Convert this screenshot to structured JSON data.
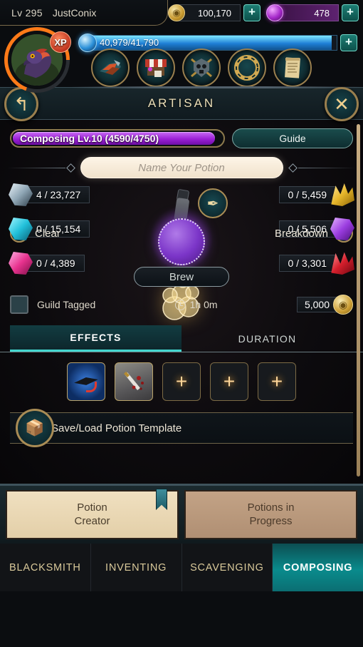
{
  "header": {
    "level_label": "Lv 295",
    "player_name": "JustConix",
    "gold": "100,170",
    "gems": "478",
    "plus_label": "+",
    "xp_badge": "XP",
    "xp_value": "40,979/41,790"
  },
  "nav_icons": [
    {
      "name": "crafting-icon"
    },
    {
      "name": "market-icon"
    },
    {
      "name": "pvp-skull-icon"
    },
    {
      "name": "compass-icon"
    },
    {
      "name": "scroll-icon"
    }
  ],
  "artisan": {
    "title": "ARTISAN",
    "back_icon": "↰",
    "close_icon": "✕",
    "skill_bar": "Composing Lv.10 (4590/4750)",
    "skill_fill_percent": 96.6,
    "guide_label": "Guide"
  },
  "potion": {
    "name_placeholder": "Name Your Potion",
    "pen_icon": "✒",
    "clear_label": "Clear",
    "clear_icon": "✕",
    "breakdown_label": "Breakdown",
    "breakdown_icon": "+",
    "brew_label": "Brew",
    "guild_tagged_label": "Guild Tagged",
    "duration": "1h 0m",
    "cost": "5,000"
  },
  "resources": {
    "left": [
      {
        "icon": "white-crystal-icon",
        "value": "4 / 23,727"
      },
      {
        "icon": "cyan-crystal-icon",
        "value": "0 / 15,154"
      },
      {
        "icon": "pink-crystal-icon",
        "value": "0 / 4,389"
      }
    ],
    "right": [
      {
        "icon": "gold-crystal-icon",
        "value": "0 / 5,459"
      },
      {
        "icon": "purple-crystal-icon",
        "value": "0 / 5,506"
      },
      {
        "icon": "red-crystal-icon",
        "value": "0 / 3,301"
      }
    ]
  },
  "tabs": {
    "effects": "EFFECTS",
    "duration": "DURATION",
    "active": "EFFECTS"
  },
  "slots": [
    {
      "type": "filled",
      "icon": "graduation-cap-icon"
    },
    {
      "type": "filled",
      "icon": "bloody-dagger-icon"
    },
    {
      "type": "empty",
      "icon": "plus-icon",
      "label": "+"
    },
    {
      "type": "empty",
      "icon": "plus-icon",
      "label": "+"
    },
    {
      "type": "empty",
      "icon": "plus-icon",
      "label": "+"
    }
  ],
  "template": {
    "label": "Save/Load Potion Template",
    "icon": "save-load-icon"
  },
  "subtabs": [
    {
      "label": "Potion\nCreator",
      "line1": "Potion",
      "line2": "Creator",
      "active": true
    },
    {
      "label": "Potions in Progress",
      "line1": "Potions in",
      "line2": "Progress",
      "active": false
    }
  ],
  "bottom_nav": [
    {
      "label": "BLACKSMITH",
      "active": false
    },
    {
      "label": "INVENTING",
      "active": false
    },
    {
      "label": "SCAVENGING",
      "active": false
    },
    {
      "label": "COMPOSING",
      "active": true
    }
  ],
  "colors": {
    "accent_teal": "#0a8b8c",
    "skill_purple": "#9b1fd6",
    "gold_trim": "#a98c55"
  }
}
